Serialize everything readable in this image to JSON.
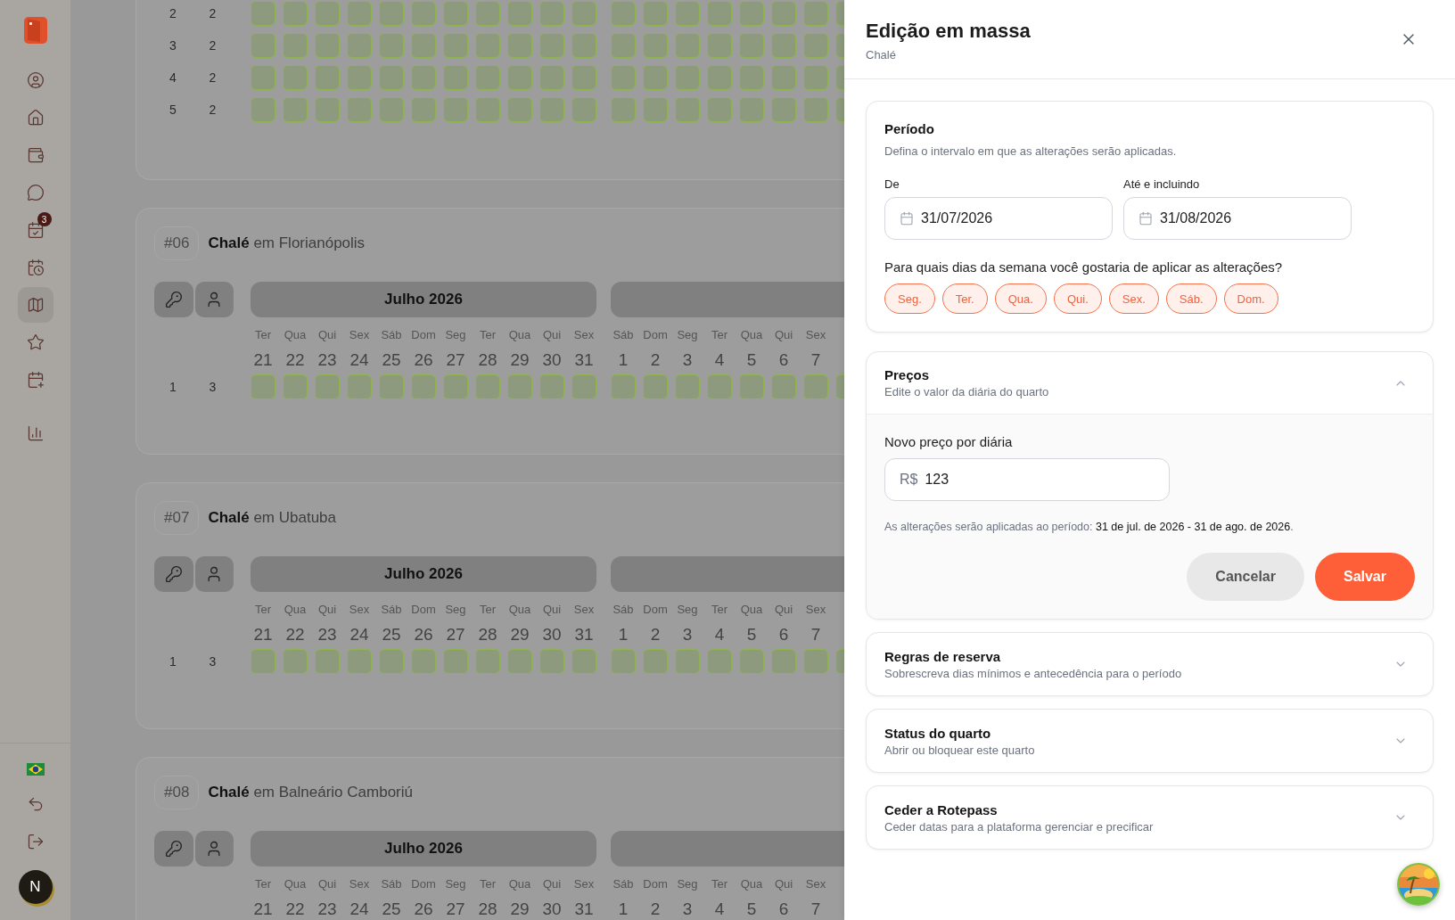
{
  "sidebar": {
    "avatar_initial": "N",
    "items": [
      {
        "selected": false
      },
      {
        "selected": false
      },
      {
        "selected": false
      },
      {
        "selected": false
      },
      {
        "selected": false,
        "badge": "3"
      },
      {
        "selected": false
      },
      {
        "selected": true
      },
      {
        "selected": false
      },
      {
        "selected": false
      }
    ],
    "secondary_items": [
      {
        "selected": false
      }
    ]
  },
  "rooms": [
    {
      "rows": [
        {
          "column_1": "2",
          "column_2": "2"
        },
        {
          "column_1": "3",
          "column_2": "2"
        },
        {
          "column_1": "4",
          "column_2": "2"
        },
        {
          "column_1": "5",
          "column_2": "2"
        }
      ]
    },
    {
      "number": "#06",
      "name": "Chalé",
      "location": "em Florianópolis",
      "months": [
        {
          "label": "Julho 2026",
          "days": [
            {
              "weekday": "Ter",
              "day": "21"
            },
            {
              "weekday": "Qua",
              "day": "22"
            },
            {
              "weekday": "Qui",
              "day": "23"
            },
            {
              "weekday": "Sex",
              "day": "24"
            },
            {
              "weekday": "Sáb",
              "day": "25"
            },
            {
              "weekday": "Dom",
              "day": "26"
            },
            {
              "weekday": "Seg",
              "day": "27"
            },
            {
              "weekday": "Ter",
              "day": "28"
            },
            {
              "weekday": "Qua",
              "day": "29"
            },
            {
              "weekday": "Qui",
              "day": "30"
            },
            {
              "weekday": "Sex",
              "day": "31"
            }
          ]
        },
        {
          "days": [
            {
              "weekday": "Sáb",
              "day": "1"
            },
            {
              "weekday": "Dom",
              "day": "2"
            },
            {
              "weekday": "Seg",
              "day": "3"
            },
            {
              "weekday": "Ter",
              "day": "4"
            },
            {
              "weekday": "Qua",
              "day": "5"
            },
            {
              "weekday": "Qui",
              "day": "6"
            },
            {
              "weekday": "Sex",
              "day": "7"
            }
          ]
        }
      ],
      "rows": [
        {
          "column_1": "1",
          "column_2": "3"
        }
      ]
    },
    {
      "number": "#07",
      "name": "Chalé",
      "location": "em Ubatuba",
      "months": [
        {
          "label": "Julho 2026",
          "days": [
            {
              "weekday": "Ter",
              "day": "21"
            },
            {
              "weekday": "Qua",
              "day": "22"
            },
            {
              "weekday": "Qui",
              "day": "23"
            },
            {
              "weekday": "Sex",
              "day": "24"
            },
            {
              "weekday": "Sáb",
              "day": "25"
            },
            {
              "weekday": "Dom",
              "day": "26"
            },
            {
              "weekday": "Seg",
              "day": "27"
            },
            {
              "weekday": "Ter",
              "day": "28"
            },
            {
              "weekday": "Qua",
              "day": "29"
            },
            {
              "weekday": "Qui",
              "day": "30"
            },
            {
              "weekday": "Sex",
              "day": "31"
            }
          ]
        },
        {
          "days": [
            {
              "weekday": "Sáb",
              "day": "1"
            },
            {
              "weekday": "Dom",
              "day": "2"
            },
            {
              "weekday": "Seg",
              "day": "3"
            },
            {
              "weekday": "Ter",
              "day": "4"
            },
            {
              "weekday": "Qua",
              "day": "5"
            },
            {
              "weekday": "Qui",
              "day": "6"
            },
            {
              "weekday": "Sex",
              "day": "7"
            }
          ]
        }
      ],
      "rows": [
        {
          "column_1": "1",
          "column_2": "3"
        }
      ]
    },
    {
      "number": "#08",
      "name": "Chalé",
      "location": "em Balneário Camboriú",
      "months": [
        {
          "label": "Julho 2026",
          "days": [
            {
              "weekday": "Ter",
              "day": "21"
            },
            {
              "weekday": "Qua",
              "day": "22"
            },
            {
              "weekday": "Qui",
              "day": "23"
            },
            {
              "weekday": "Sex",
              "day": "24"
            },
            {
              "weekday": "Sáb",
              "day": "25"
            },
            {
              "weekday": "Dom",
              "day": "26"
            },
            {
              "weekday": "Seg",
              "day": "27"
            },
            {
              "weekday": "Ter",
              "day": "28"
            },
            {
              "weekday": "Qua",
              "day": "29"
            },
            {
              "weekday": "Qui",
              "day": "30"
            },
            {
              "weekday": "Sex",
              "day": "31"
            }
          ]
        },
        {
          "days": [
            {
              "weekday": "Sáb",
              "day": "1"
            },
            {
              "weekday": "Dom",
              "day": "2"
            },
            {
              "weekday": "Seg",
              "day": "3"
            },
            {
              "weekday": "Ter",
              "day": "4"
            },
            {
              "weekday": "Qua",
              "day": "5"
            },
            {
              "weekday": "Qui",
              "day": "6"
            },
            {
              "weekday": "Sex",
              "day": "7"
            }
          ]
        }
      ]
    }
  ],
  "drawer": {
    "title": "Edição em massa",
    "subtitle": "Chalé",
    "period": {
      "title": "Período",
      "description": "Defina o intervalo em que as alterações serão aplicadas.",
      "from": {
        "label": "De",
        "value": "31/07/2026"
      },
      "to": {
        "label": "Até e incluindo",
        "value": "31/08/2026"
      },
      "weekdays_question": "Para quais dias da semana você gostaria de aplicar as alterações?",
      "weekdays": [
        {
          "label": "Seg.",
          "selected": true
        },
        {
          "label": "Ter.",
          "selected": true
        },
        {
          "label": "Qua.",
          "selected": true
        },
        {
          "label": "Qui.",
          "selected": true
        },
        {
          "label": "Sex.",
          "selected": true
        },
        {
          "label": "Sáb.",
          "selected": true
        },
        {
          "label": "Dom.",
          "selected": true
        }
      ]
    },
    "sections": [
      {
        "kind": "prices",
        "title": "Preços",
        "description": "Edite o valor da diária do quarto",
        "expanded": true,
        "price_label": "Novo preço por diária",
        "currency": "R$",
        "price_value": "123",
        "summary": "As alterações serão aplicadas ao período: **31 de jul. de 2026 - 31 de ago. de 2026**.",
        "buttons": [
          {
            "kind": "secondary",
            "label": "Cancelar"
          },
          {
            "kind": "primary",
            "label": "Salvar"
          }
        ]
      },
      {
        "kind": "rules",
        "title": "Regras de reserva",
        "description": "Sobrescreva dias mínimos e antecedência para o período",
        "expanded": false
      },
      {
        "kind": "status",
        "title": "Status do quarto",
        "description": "Abrir ou bloquear este quarto",
        "expanded": false
      },
      {
        "kind": "cede",
        "title": "Ceder a Rotepass",
        "description": "Ceder datas para a plataforma gerenciar e precificar",
        "expanded": false
      }
    ]
  }
}
